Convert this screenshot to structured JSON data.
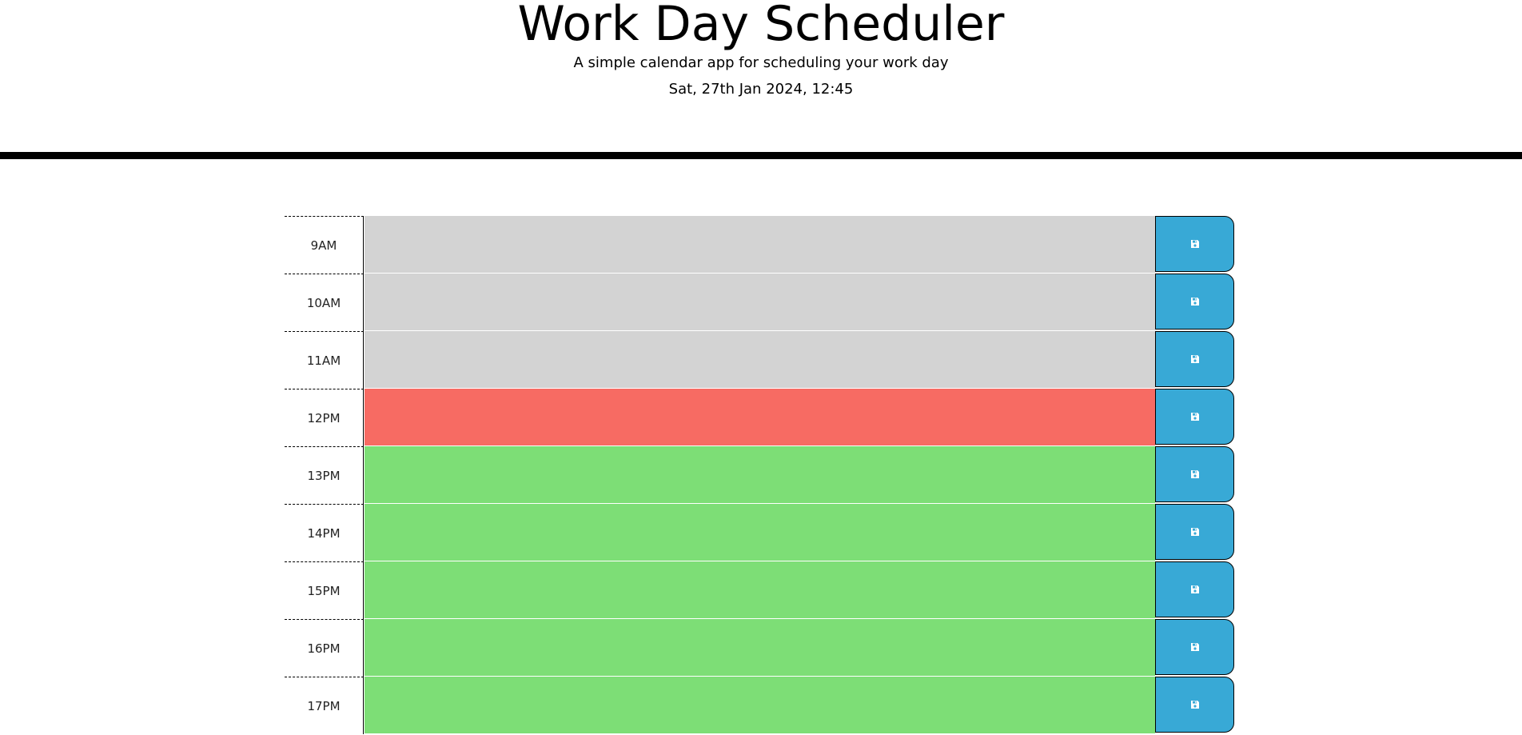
{
  "header": {
    "title": "Work Day Scheduler",
    "lead": "A simple calendar app for scheduling your work day",
    "current_day": "Sat, 27th Jan 2024, 12:45"
  },
  "colors": {
    "past": "#d3d3d3",
    "present": "#f76b63",
    "future": "#7dde76",
    "save_button": "#38a9d6"
  },
  "save_icon": "floppy-disk-icon",
  "time_blocks": [
    {
      "hour": "9AM",
      "status": "past",
      "text": ""
    },
    {
      "hour": "10AM",
      "status": "past",
      "text": ""
    },
    {
      "hour": "11AM",
      "status": "past",
      "text": ""
    },
    {
      "hour": "12PM",
      "status": "present",
      "text": ""
    },
    {
      "hour": "13PM",
      "status": "future",
      "text": ""
    },
    {
      "hour": "14PM",
      "status": "future",
      "text": ""
    },
    {
      "hour": "15PM",
      "status": "future",
      "text": ""
    },
    {
      "hour": "16PM",
      "status": "future",
      "text": ""
    },
    {
      "hour": "17PM",
      "status": "future",
      "text": ""
    }
  ]
}
